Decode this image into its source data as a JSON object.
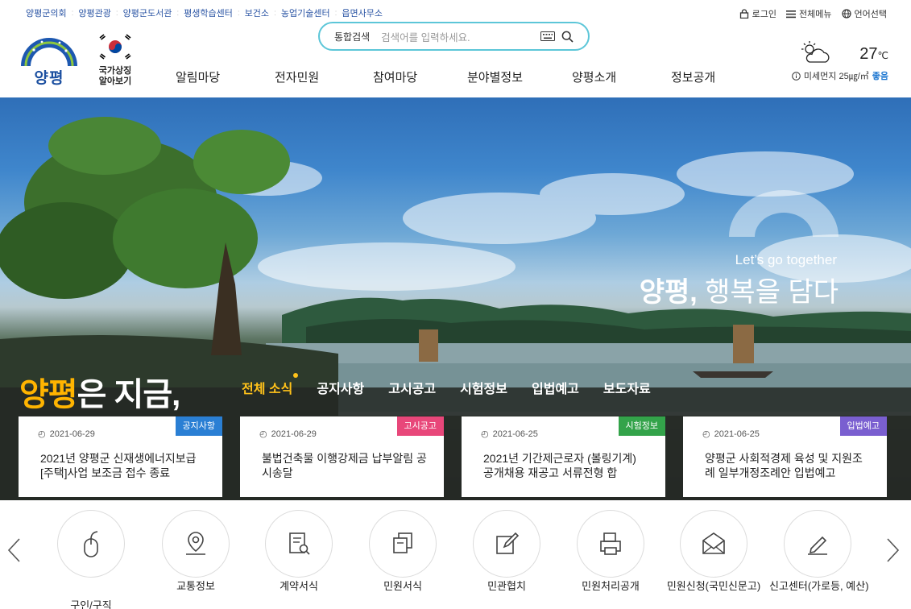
{
  "top_links": [
    "양평군의회",
    "양평관광",
    "양평군도서관",
    "평생학습센터",
    "보건소",
    "농업기술센터",
    "읍면사무소"
  ],
  "util_menu": {
    "login": "로그인",
    "all_menu": "전체메뉴",
    "language": "언어선택"
  },
  "logo": {
    "slogan": "맑은행복",
    "text": "양평"
  },
  "national_symbol": {
    "line1": "국가상징",
    "line2": "알아보기"
  },
  "search": {
    "scope": "통합검색",
    "placeholder": "검색어를 입력하세요."
  },
  "gnb": [
    "알림마당",
    "전자민원",
    "참여마당",
    "분야별정보",
    "양평소개",
    "정보공개"
  ],
  "weather": {
    "temp": "27",
    "unit": "℃",
    "dust_label": "미세먼지 25㎍/㎥",
    "dust_grade": "좋음"
  },
  "hero": {
    "slogan_small": "Let’s go together",
    "slogan_bold": "양평,",
    "slogan_rest": " 행복을 담다"
  },
  "news": {
    "title_highlight": "양평",
    "title_rest": "은 지금,",
    "tabs": [
      "전체 소식",
      "공지사항",
      "고시공고",
      "시험정보",
      "입법예고",
      "보도자료"
    ],
    "cards": [
      {
        "date": "2021-06-29",
        "badge": "공지사항",
        "title": "2021년 양평군 신재생에너지보급[주택]사업 보조금 접수 종료"
      },
      {
        "date": "2021-06-29",
        "badge": "고시공고",
        "title": "불법건축물 이행강제금 납부알림 공시송달"
      },
      {
        "date": "2021-06-25",
        "badge": "시험정보",
        "title": "2021년 기간제근로자 (볼링기계) 공개채용 재공고 서류전형 합"
      },
      {
        "date": "2021-06-25",
        "badge": "입법예고",
        "title": "양평군 사회적경제 육성 및 지원조례 일부개정조례안 입법예고"
      }
    ],
    "badge_colors": [
      "#2a7fd4",
      "#e8477a",
      "#33a34a",
      "#7a5fd0"
    ]
  },
  "quick_menu": [
    "구인/구직",
    "교통정보",
    "계약서식",
    "민원서식",
    "민관협치",
    "민원처리공개",
    "민원신청(국민신문고)",
    "신고센터(가로등, 예산)"
  ]
}
